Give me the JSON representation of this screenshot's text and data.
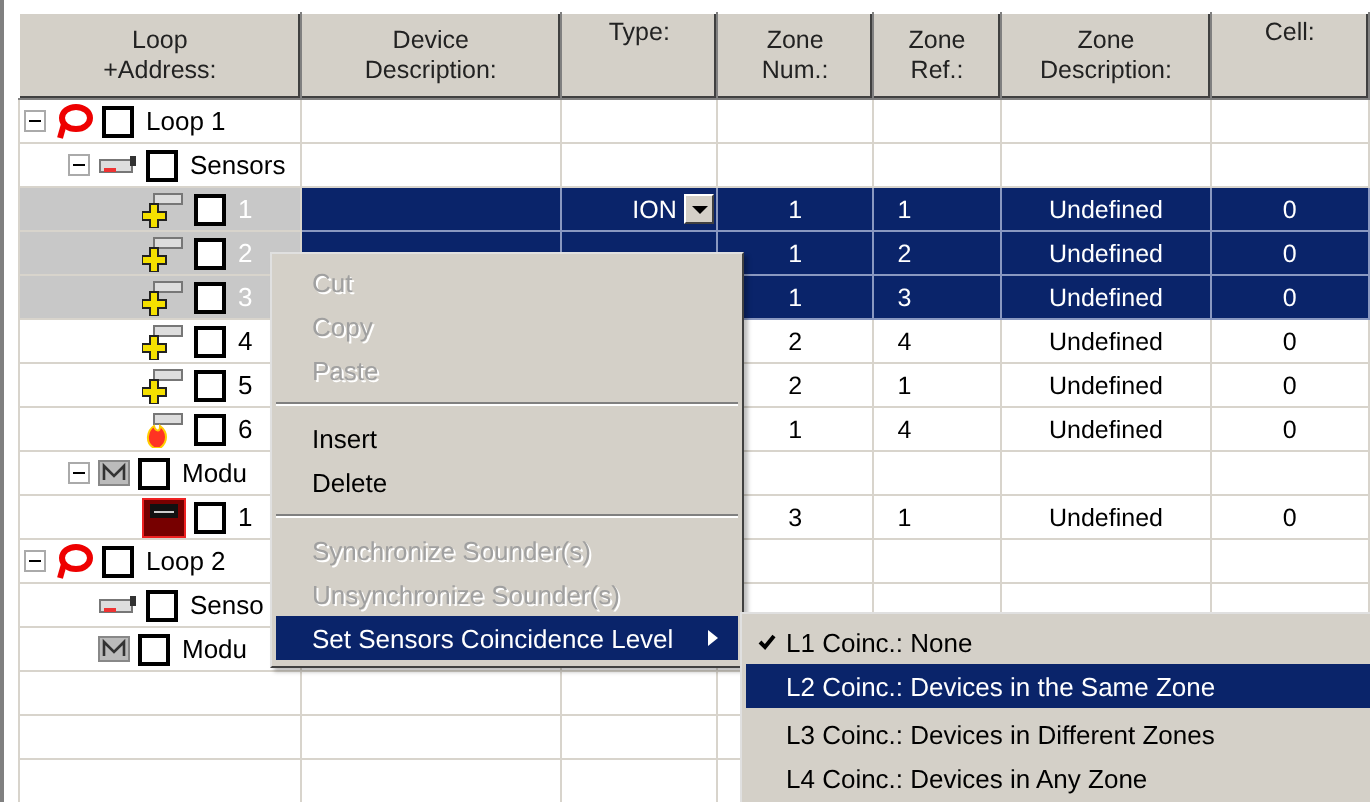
{
  "columns": [
    {
      "label": "Loop\n+Address:"
    },
    {
      "label": "Device\nDescription:"
    },
    {
      "label": "Type:"
    },
    {
      "label": "Zone\nNum.:"
    },
    {
      "label": "Zone\nRef.:"
    },
    {
      "label": "Zone\nDescription:"
    },
    {
      "label": "Cell:"
    }
  ],
  "tree": [
    {
      "label": "Loop 1",
      "kind": "loop",
      "expanded": true,
      "checked": false,
      "selected": false,
      "children": [
        {
          "label": "Sensors",
          "kind": "sensor-group",
          "expanded": true,
          "checked": false,
          "selected": false,
          "children": [
            {
              "label": "1",
              "kind": "sensor",
              "checked": false,
              "selected": true,
              "editing": true,
              "type": "ION",
              "zone_num": "1",
              "zone_ref": "1",
              "zone_description": "Undefined",
              "cell": "0"
            },
            {
              "label": "2",
              "kind": "sensor",
              "checked": false,
              "selected": true,
              "editing": false,
              "zone_num": "1",
              "zone_ref": "2",
              "zone_description": "Undefined",
              "cell": "0"
            },
            {
              "label": "3",
              "kind": "sensor",
              "checked": false,
              "selected": true,
              "editing": false,
              "zone_num": "1",
              "zone_ref": "3",
              "zone_description": "Undefined",
              "cell": "0"
            },
            {
              "label": "4",
              "kind": "sensor",
              "checked": false,
              "selected": false,
              "zone_num": "2",
              "zone_ref": "4",
              "zone_description": "Undefined",
              "cell": "0"
            },
            {
              "label": "5",
              "kind": "sensor",
              "checked": false,
              "selected": false,
              "zone_num": "2",
              "zone_ref": "1",
              "zone_description": "Undefined",
              "cell": "0"
            },
            {
              "label": "6",
              "kind": "heat-sensor",
              "checked": false,
              "selected": false,
              "zone_num": "1",
              "zone_ref": "4",
              "zone_description": "Undefined",
              "cell": "0"
            }
          ]
        },
        {
          "label": "Modu",
          "kind": "module-group",
          "expanded": true,
          "checked": false,
          "selected": false,
          "children": [
            {
              "label": "1",
              "kind": "module",
              "checked": false,
              "selected": false,
              "zone_num": "3",
              "zone_ref": "1",
              "zone_description": "Undefined",
              "cell": "0"
            }
          ]
        }
      ]
    },
    {
      "label": "Loop 2",
      "kind": "loop",
      "expanded": true,
      "checked": false,
      "selected": false,
      "children": [
        {
          "label": "Senso",
          "kind": "sensor-group",
          "checked": false,
          "selected": false
        },
        {
          "label": "Modu",
          "kind": "module-group",
          "checked": false,
          "selected": false
        }
      ]
    }
  ],
  "context_menu": {
    "items": [
      {
        "kind": "item",
        "label": "Cut",
        "disabled": true,
        "selected": false
      },
      {
        "kind": "item",
        "label": "Copy",
        "disabled": true,
        "selected": false
      },
      {
        "kind": "item",
        "label": "Paste",
        "disabled": true,
        "selected": false
      },
      {
        "kind": "separator"
      },
      {
        "kind": "item",
        "label": "Insert",
        "disabled": false,
        "selected": false
      },
      {
        "kind": "item",
        "label": "Delete",
        "disabled": false,
        "selected": false
      },
      {
        "kind": "separator"
      },
      {
        "kind": "item",
        "label": "Synchronize Sounder(s)",
        "disabled": true,
        "selected": false
      },
      {
        "kind": "item",
        "label": "Unsynchronize Sounder(s)",
        "disabled": true,
        "selected": false
      },
      {
        "kind": "item",
        "label": "Set Sensors Coincidence Level",
        "disabled": false,
        "selected": true,
        "submenu": true
      }
    ]
  },
  "submenu": {
    "items": [
      {
        "label": "L1 Coinc.: None",
        "checked": true,
        "selected": false
      },
      {
        "label": "L2 Coinc.: Devices in the Same Zone",
        "checked": false,
        "selected": true
      },
      {
        "label": "L3 Coinc.: Devices in Different Zones",
        "checked": false,
        "selected": false
      },
      {
        "label": "L4 Coinc.: Devices in Any Zone",
        "checked": false,
        "selected": false
      }
    ]
  }
}
